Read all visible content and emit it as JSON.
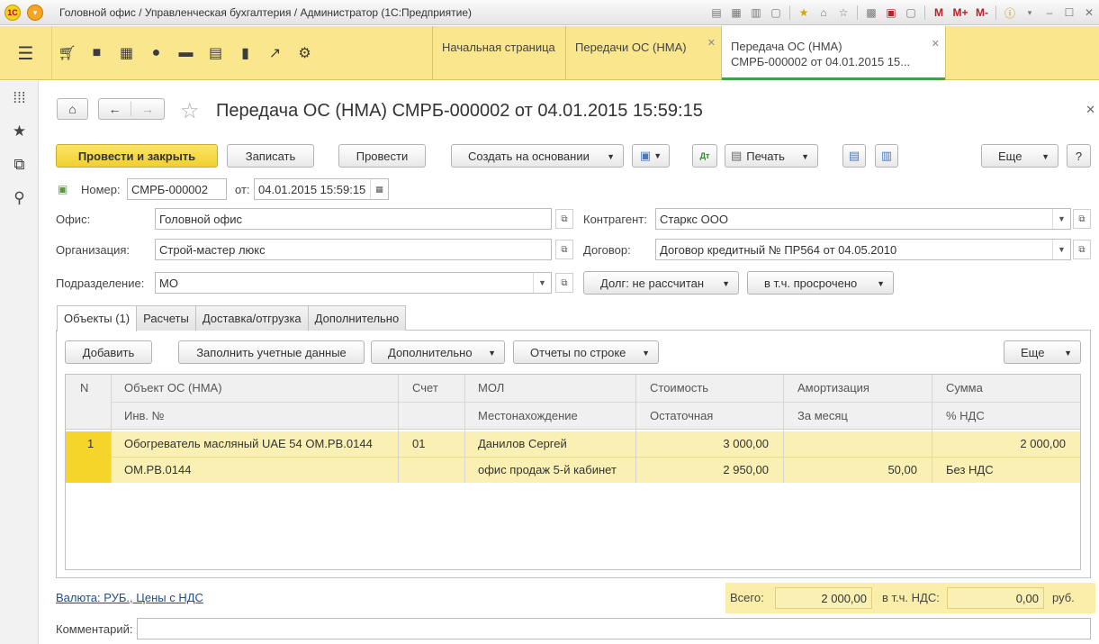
{
  "window": {
    "title": "Головной офис / Управленческая бухгалтерия / Администратор  (1С:Предприятие)",
    "logo_text": "1С",
    "toolbar_letters": [
      "M",
      "M+",
      "M-"
    ]
  },
  "section_icons": [
    "menu-icon",
    "cart-icon",
    "bag-icon",
    "warehouse-icon",
    "ruble-icon",
    "truck-icon",
    "documents-icon",
    "chart-icon",
    "trend-icon",
    "gear-icon"
  ],
  "tabs": [
    {
      "label": "Начальная страница"
    },
    {
      "label": "Передачи ОС (НМА)"
    },
    {
      "label_line1": "Передача ОС (НМА)",
      "label_line2": "СМРБ-000002 от 04.01.2015 15..."
    }
  ],
  "sidebar": [
    "apps-icon",
    "star-icon",
    "history-icon",
    "search-icon"
  ],
  "document": {
    "title": "Передача ОС (НМА) СМРБ-000002 от 04.01.2015 15:59:15"
  },
  "command_bar": {
    "post_close": "Провести и закрыть",
    "save": "Записать",
    "post": "Провести",
    "create_based": "Создать на основании",
    "print": "Печать",
    "more": "Еще",
    "help": "?"
  },
  "header": {
    "number_label": "Номер:",
    "number_value": "СМРБ-000002",
    "date_label": "от:",
    "date_value": "04.01.2015 15:59:15",
    "office_label": "Офис:",
    "office_value": "Головной офис",
    "org_label": "Организация:",
    "org_value": "Строй-мастер люкс",
    "dept_label": "Подразделение:",
    "dept_value": "МО",
    "counterparty_label": "Контрагент:",
    "counterparty_value": "Старкс ООО",
    "contract_label": "Договор:",
    "contract_value": "Договор кредитный № ПР564 от 04.05.2010",
    "debt_btn": "Долг: не рассчитан",
    "overdue_btn": "в т.ч. просрочено"
  },
  "subtabs": [
    "Объекты (1)",
    "Расчеты",
    "Доставка/отгрузка",
    "Дополнительно"
  ],
  "table_toolbar": {
    "add": "Добавить",
    "fill": "Заполнить учетные данные",
    "extra": "Дополнительно",
    "reports": "Отчеты по строке",
    "more": "Еще"
  },
  "table": {
    "headers_top": [
      "N",
      "Объект ОС (НМА)",
      "Счет",
      "МОЛ",
      "Стоимость",
      "Амортизация",
      "Сумма"
    ],
    "headers_bottom": [
      "Инв. №",
      "Местонахождение",
      "Остаточная",
      "За месяц",
      "% НДС"
    ],
    "rows": [
      {
        "n": "1",
        "object": "Обогреватель масляный UAE 54 ОМ.РВ.0144",
        "inv": "ОМ.РВ.0144",
        "account": "01",
        "mol": "Данилов Сергей",
        "location": "офис продаж 5-й кабинет",
        "cost": "3 000,00",
        "residual": "2 950,00",
        "amort": "",
        "amort_month": "50,00",
        "sum": "2 000,00",
        "vat": "Без НДС"
      }
    ]
  },
  "footer": {
    "currency_link": "Валюта: РУБ., Цены с НДС",
    "total_label": "Всего:",
    "total_value": "2 000,00",
    "vat_label": "в т.ч. НДС:",
    "vat_value": "0,00",
    "currency": "руб.",
    "comment_label": "Комментарий:",
    "comment_value": ""
  }
}
